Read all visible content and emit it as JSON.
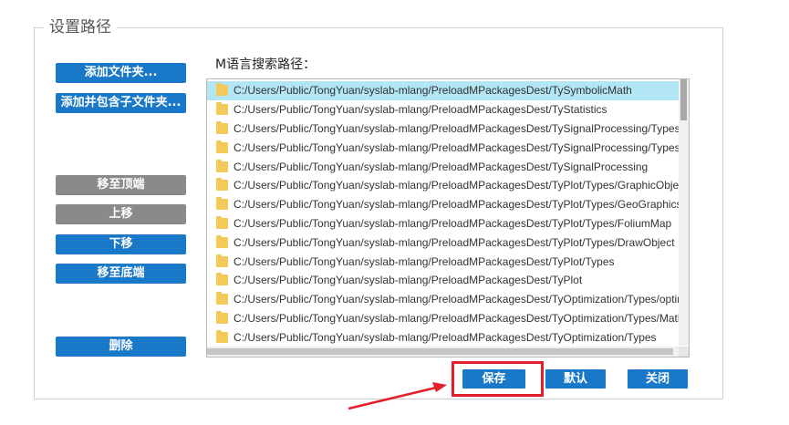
{
  "group": {
    "title": "设置路径"
  },
  "buttons": {
    "add_folder": "添加文件夹...",
    "add_with_subfolders": "添加并包含子文件夹...",
    "move_to_top": "移至顶端",
    "move_up": "上移",
    "move_down": "下移",
    "move_to_bottom": "移至底端",
    "delete": "删除",
    "save": "保存",
    "default": "默认",
    "close": "关闭"
  },
  "path_list": {
    "label": "M语言搜索路径：",
    "selected_index": 0,
    "items": [
      "C:/Users/Public/TongYuan/syslab-mlang/PreloadMPackagesDest/TySymbolicMath",
      "C:/Users/Public/TongYuan/syslab-mlang/PreloadMPackagesDest/TyStatistics",
      "C:/Users/Public/TongYuan/syslab-mlang/PreloadMPackagesDest/TySignalProcessing/Types/EDFIn",
      "C:/Users/Public/TongYuan/syslab-mlang/PreloadMPackagesDest/TySignalProcessing/Types",
      "C:/Users/Public/TongYuan/syslab-mlang/PreloadMPackagesDest/TySignalProcessing",
      "C:/Users/Public/TongYuan/syslab-mlang/PreloadMPackagesDest/TyPlot/Types/GraphicObject",
      "C:/Users/Public/TongYuan/syslab-mlang/PreloadMPackagesDest/TyPlot/Types/GeoGraphics",
      "C:/Users/Public/TongYuan/syslab-mlang/PreloadMPackagesDest/TyPlot/Types/FoliumMap",
      "C:/Users/Public/TongYuan/syslab-mlang/PreloadMPackagesDest/TyPlot/Types/DrawObject",
      "C:/Users/Public/TongYuan/syslab-mlang/PreloadMPackagesDest/TyPlot/Types",
      "C:/Users/Public/TongYuan/syslab-mlang/PreloadMPackagesDest/TyPlot",
      "C:/Users/Public/TongYuan/syslab-mlang/PreloadMPackagesDest/TyOptimization/Types/optimopt",
      "C:/Users/Public/TongYuan/syslab-mlang/PreloadMPackagesDest/TyOptimization/Types/MathOpti",
      "C:/Users/Public/TongYuan/syslab-mlang/PreloadMPackagesDest/TyOptimization/Types"
    ],
    "item_icon": "folder-icon"
  },
  "colors": {
    "primary_button": "#1a78c8",
    "disabled_button": "#8a8a8a",
    "selection": "#b3e6f5",
    "folder": "#f3c95a",
    "annotation": "#e3202a"
  }
}
